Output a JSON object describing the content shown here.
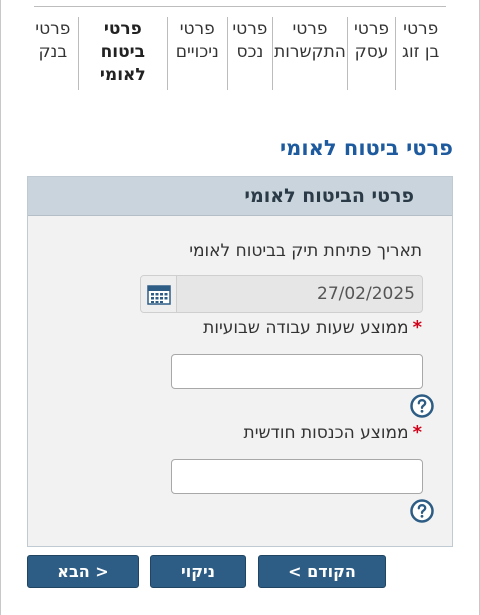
{
  "tabs": [
    {
      "label": "פרטי\nבן זוג"
    },
    {
      "label": "פרטי\nעסק"
    },
    {
      "label": "פרטי\nהתקשרות"
    },
    {
      "label": "פרטי\nנכס"
    },
    {
      "label": "פרטי\nניכויים"
    },
    {
      "label": "פרטי\nביטוח\nלאומי",
      "active": true
    },
    {
      "label": "פרטי\nבנק"
    }
  ],
  "section_title": "פרטי ביטוח לאומי",
  "panel": {
    "header": "פרטי הביטוח לאומי",
    "open_date_label": "תאריך פתיחת תיק בביטוח לאומי",
    "open_date_value": "27/02/2025",
    "weekly_hours_label": "ממוצע שעות עבודה שבועיות",
    "weekly_hours_value": "",
    "monthly_income_label": "ממוצע הכנסות חודשית",
    "monthly_income_value": "",
    "required_mark": "*"
  },
  "buttons": {
    "prev": "< הקודם",
    "clear": "ניקוי",
    "next": "הבא >"
  },
  "colors": {
    "title": "#1e5a9e",
    "button": "#2d5d84",
    "header_bg": "#c9d4dc",
    "required": "#d0021b"
  }
}
